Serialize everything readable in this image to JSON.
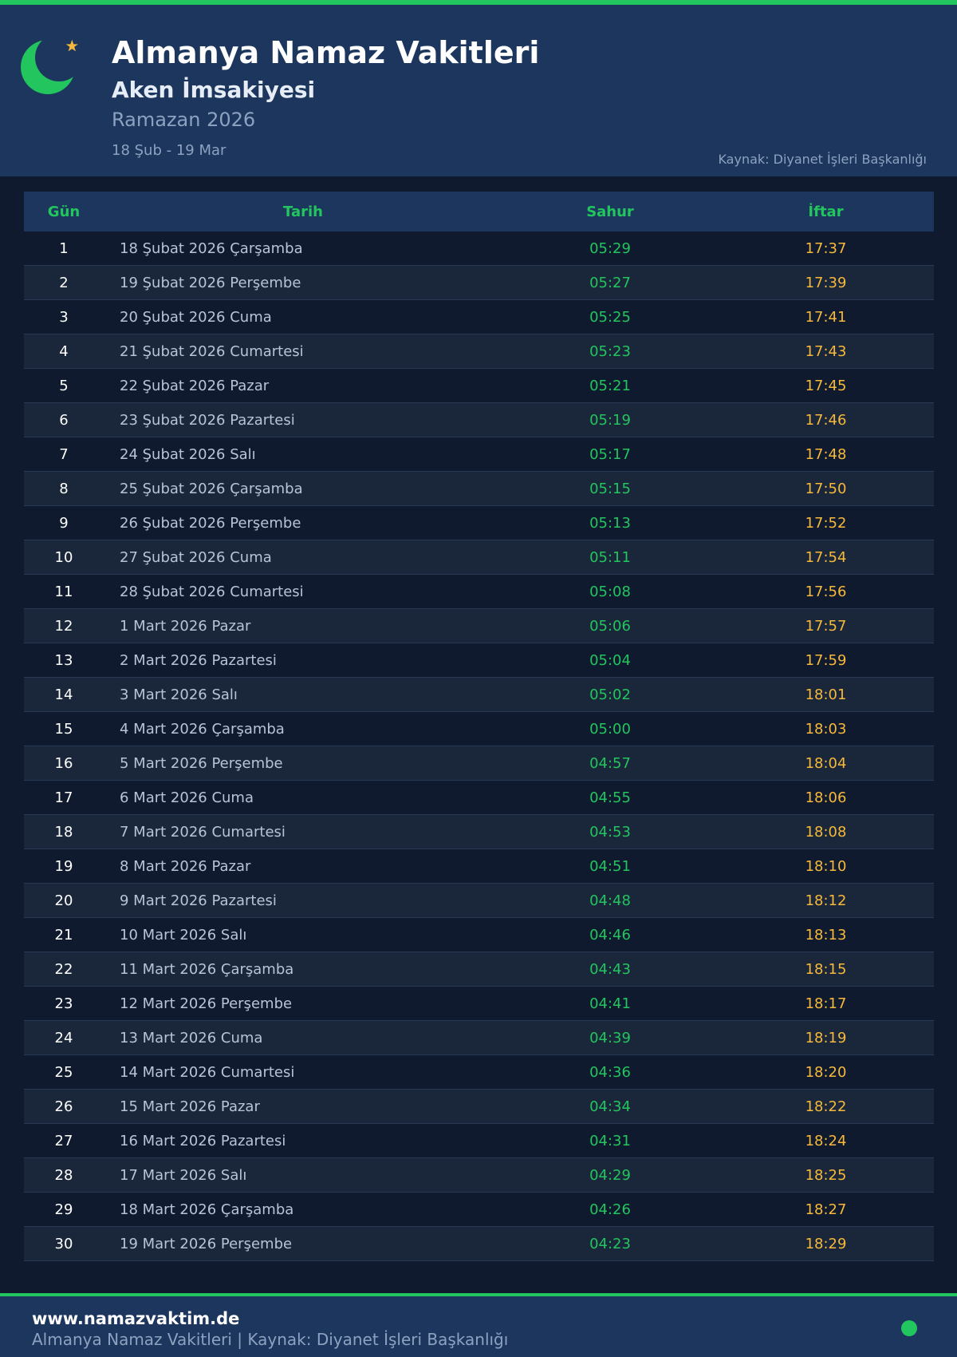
{
  "header": {
    "title": "Almanya Namaz Vakitleri",
    "subtitle": "Aken İmsakiyesi",
    "year": "Ramazan 2026",
    "range": "18 Şub - 19 Mar",
    "source": "Kaynak: Diyanet İşleri Başkanlığı"
  },
  "table": {
    "headers": [
      "Gün",
      "Tarih",
      "Sahur",
      "İftar"
    ],
    "rows": [
      {
        "day": "1",
        "date": "18 Şubat 2026 Çarşamba",
        "sahur": "05:29",
        "iftar": "17:37"
      },
      {
        "day": "2",
        "date": "19 Şubat 2026 Perşembe",
        "sahur": "05:27",
        "iftar": "17:39"
      },
      {
        "day": "3",
        "date": "20 Şubat 2026 Cuma",
        "sahur": "05:25",
        "iftar": "17:41"
      },
      {
        "day": "4",
        "date": "21 Şubat 2026 Cumartesi",
        "sahur": "05:23",
        "iftar": "17:43"
      },
      {
        "day": "5",
        "date": "22 Şubat 2026 Pazar",
        "sahur": "05:21",
        "iftar": "17:45"
      },
      {
        "day": "6",
        "date": "23 Şubat 2026 Pazartesi",
        "sahur": "05:19",
        "iftar": "17:46"
      },
      {
        "day": "7",
        "date": "24 Şubat 2026 Salı",
        "sahur": "05:17",
        "iftar": "17:48"
      },
      {
        "day": "8",
        "date": "25 Şubat 2026 Çarşamba",
        "sahur": "05:15",
        "iftar": "17:50"
      },
      {
        "day": "9",
        "date": "26 Şubat 2026 Perşembe",
        "sahur": "05:13",
        "iftar": "17:52"
      },
      {
        "day": "10",
        "date": "27 Şubat 2026 Cuma",
        "sahur": "05:11",
        "iftar": "17:54"
      },
      {
        "day": "11",
        "date": "28 Şubat 2026 Cumartesi",
        "sahur": "05:08",
        "iftar": "17:56"
      },
      {
        "day": "12",
        "date": "1 Mart 2026 Pazar",
        "sahur": "05:06",
        "iftar": "17:57"
      },
      {
        "day": "13",
        "date": "2 Mart 2026 Pazartesi",
        "sahur": "05:04",
        "iftar": "17:59"
      },
      {
        "day": "14",
        "date": "3 Mart 2026 Salı",
        "sahur": "05:02",
        "iftar": "18:01"
      },
      {
        "day": "15",
        "date": "4 Mart 2026 Çarşamba",
        "sahur": "05:00",
        "iftar": "18:03"
      },
      {
        "day": "16",
        "date": "5 Mart 2026 Perşembe",
        "sahur": "04:57",
        "iftar": "18:04"
      },
      {
        "day": "17",
        "date": "6 Mart 2026 Cuma",
        "sahur": "04:55",
        "iftar": "18:06"
      },
      {
        "day": "18",
        "date": "7 Mart 2026 Cumartesi",
        "sahur": "04:53",
        "iftar": "18:08"
      },
      {
        "day": "19",
        "date": "8 Mart 2026 Pazar",
        "sahur": "04:51",
        "iftar": "18:10"
      },
      {
        "day": "20",
        "date": "9 Mart 2026 Pazartesi",
        "sahur": "04:48",
        "iftar": "18:12"
      },
      {
        "day": "21",
        "date": "10 Mart 2026 Salı",
        "sahur": "04:46",
        "iftar": "18:13"
      },
      {
        "day": "22",
        "date": "11 Mart 2026 Çarşamba",
        "sahur": "04:43",
        "iftar": "18:15"
      },
      {
        "day": "23",
        "date": "12 Mart 2026 Perşembe",
        "sahur": "04:41",
        "iftar": "18:17"
      },
      {
        "day": "24",
        "date": "13 Mart 2026 Cuma",
        "sahur": "04:39",
        "iftar": "18:19"
      },
      {
        "day": "25",
        "date": "14 Mart 2026 Cumartesi",
        "sahur": "04:36",
        "iftar": "18:20"
      },
      {
        "day": "26",
        "date": "15 Mart 2026 Pazar",
        "sahur": "04:34",
        "iftar": "18:22"
      },
      {
        "day": "27",
        "date": "16 Mart 2026 Pazartesi",
        "sahur": "04:31",
        "iftar": "18:24"
      },
      {
        "day": "28",
        "date": "17 Mart 2026 Salı",
        "sahur": "04:29",
        "iftar": "18:25"
      },
      {
        "day": "29",
        "date": "18 Mart 2026 Çarşamba",
        "sahur": "04:26",
        "iftar": "18:27"
      },
      {
        "day": "30",
        "date": "19 Mart 2026 Perşembe",
        "sahur": "04:23",
        "iftar": "18:29"
      }
    ]
  },
  "footer": {
    "url": "www.namazvaktim.de",
    "text": "Almanya Namaz Vakitleri | Kaynak: Diyanet İşleri Başkanlığı"
  },
  "colors": {
    "accent_green": "#22c55e",
    "iftar_gold": "#f6b93b",
    "header_bg": "#1c365d",
    "page_bg": "#0f1a2e"
  },
  "icons": {
    "logo": "crescent-moon-star-icon"
  }
}
